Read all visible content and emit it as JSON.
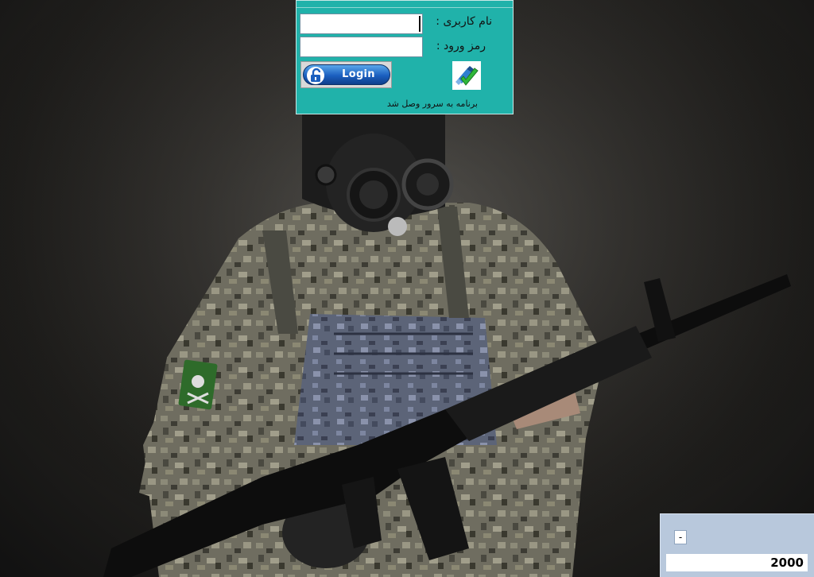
{
  "login": {
    "username_label": "نام کاربری :",
    "password_label": "رمز ورود :",
    "username_value": "",
    "password_value": "",
    "login_button_label": "Login",
    "status_text": "برنامه به سرور وصل شد",
    "panel_color": "#20b2aa"
  },
  "icons": {
    "login_lock": "unlock-icon",
    "connection": "connected-check-icon"
  },
  "corner_widget": {
    "minimize_label": "-",
    "value": "2000"
  },
  "background": {
    "subject": "soldier-with-gas-mask-and-rifle"
  }
}
